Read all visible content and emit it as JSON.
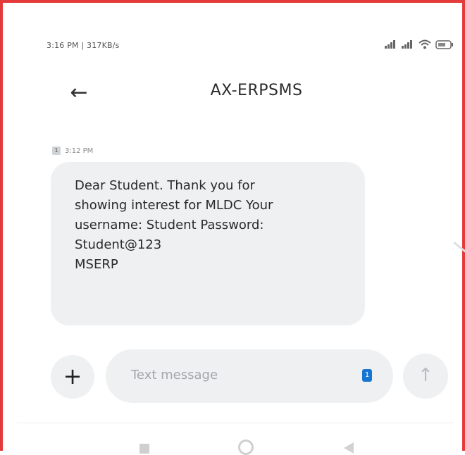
{
  "status_bar": {
    "left_text": "3:16 PM | 317KB/s",
    "icons": [
      "signal-icon",
      "signal-icon",
      "wifi-icon",
      "battery-icon"
    ]
  },
  "header": {
    "back_icon": "arrow-left-icon",
    "title": "AX-ERPSMS"
  },
  "message": {
    "sim_label": "1",
    "timestamp": "3:12 PM",
    "text": "Dear Student. Thank you for\nshowing interest for MLDC Your\nusername: Student   Password:\nStudent@123\nMSERP"
  },
  "composer": {
    "add_icon": "plus-icon",
    "placeholder": "Text message",
    "sim_label": "1",
    "send_icon": "arrow-up-icon"
  },
  "nav_bar": {
    "icons": [
      "recents-icon",
      "home-icon",
      "back-triangle-icon"
    ]
  },
  "colors": {
    "frame_border": "#e53a3a",
    "bubble": "#eef0f2",
    "sim_accent": "#1677d2"
  }
}
